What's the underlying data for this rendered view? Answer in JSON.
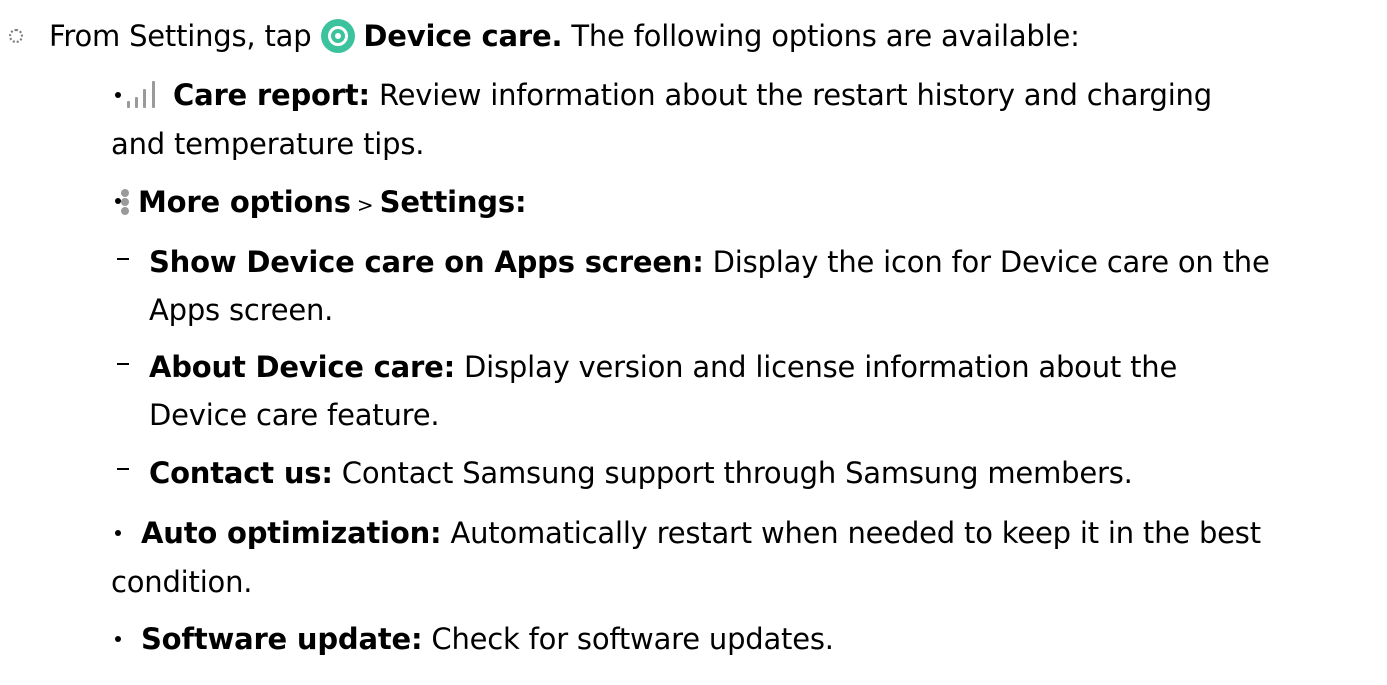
{
  "step": {
    "text_before": "From Settings, tap",
    "bold_label": "Device care.",
    "text_after": " The following options are available:",
    "icon": "device-care-icon"
  },
  "items": [
    {
      "icon": "bar-chart-icon",
      "label": "Care report",
      "sep": ":",
      "line1": " Review information about the restart history and charging",
      "line2": "and temperature tips."
    },
    {
      "icon": "more-options-icon",
      "label": "More options",
      "arrow": " > ",
      "label2": "Settings",
      "sep": ":",
      "subitems": [
        {
          "label": "Show Device care on Apps screen",
          "sep": ":",
          "line1": " Display the icon for Device care on the",
          "line2": "Apps screen."
        },
        {
          "label": "About Device care",
          "sep": ":",
          "line1": " Display version and license information about the",
          "line2": "Device care feature."
        },
        {
          "label": "Contact us",
          "sep": ":",
          "line1": " Contact Samsung support through Samsung members."
        }
      ]
    },
    {
      "label": "Auto optimization",
      "sep": ":",
      "line1": " Automatically restart when needed to keep it in the best",
      "line2": "condition."
    },
    {
      "label": "Software update",
      "sep": ":",
      "line1": " Check for software updates."
    }
  ],
  "colors": {
    "device_care_icon": "#3cc39e",
    "secondary_icon": "#9a9a9a",
    "text": "#000000"
  }
}
